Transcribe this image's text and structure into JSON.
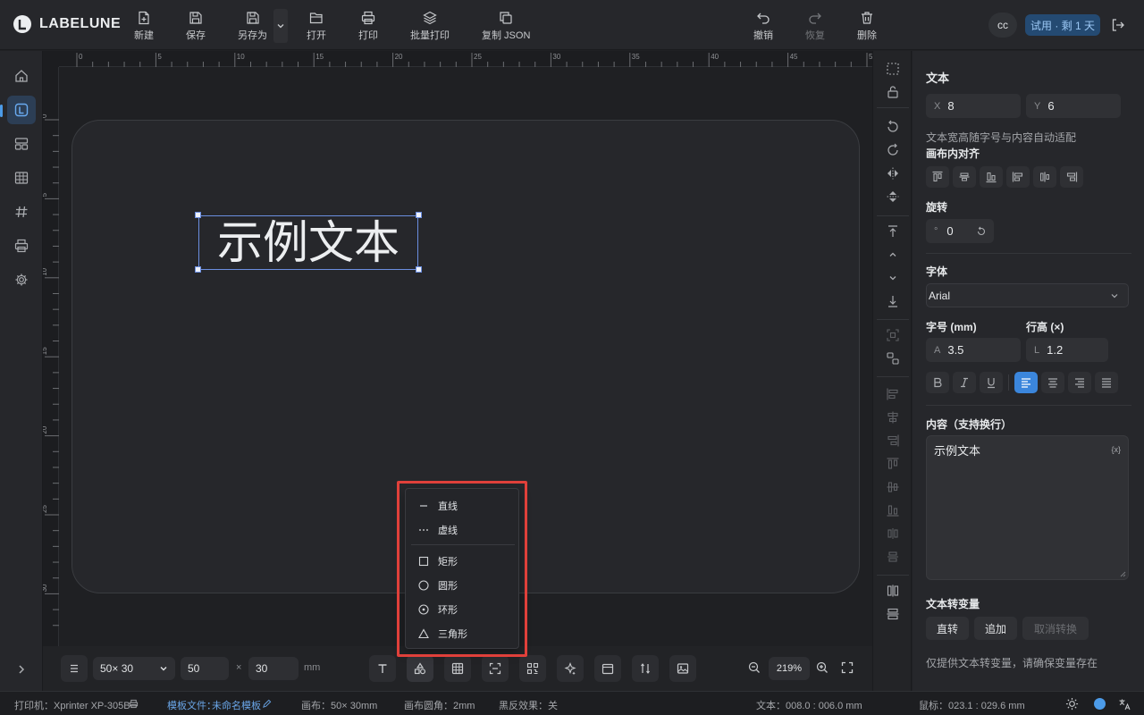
{
  "brand": {
    "name": "LABELUNE"
  },
  "toolbar": {
    "new": "新建",
    "save": "保存",
    "save_as": "另存为",
    "open": "打开",
    "print": "打印",
    "batch_print": "批量打印",
    "copy_json": "复制 JSON",
    "undo": "撤销",
    "redo": "恢复",
    "delete": "删除"
  },
  "account": {
    "avatar": "cc",
    "trial": "试用 · 剩 1 天"
  },
  "ruler": {
    "top_ticks": [
      "0",
      "5",
      "10",
      "15",
      "20",
      "25",
      "30",
      "35",
      "40",
      "45",
      "50"
    ],
    "left_ticks": [
      "0",
      "5",
      "10",
      "15",
      "20",
      "25",
      "30"
    ]
  },
  "canvas": {
    "sample_text": "示例文本"
  },
  "shape_menu": {
    "items": [
      {
        "label": "直线",
        "icon": "line-icon"
      },
      {
        "label": "虚线",
        "icon": "dashed-line-icon"
      },
      {
        "label": "矩形",
        "icon": "rectangle-icon"
      },
      {
        "label": "圆形",
        "icon": "circle-icon"
      },
      {
        "label": "环形",
        "icon": "ring-icon"
      },
      {
        "label": "三角形",
        "icon": "triangle-icon"
      }
    ]
  },
  "bottombar": {
    "size_preset": "50× 30",
    "width": "50",
    "times": "×",
    "height": "30",
    "unit": "mm",
    "zoom": "219%"
  },
  "panel": {
    "title": "文本",
    "x_prefix": "X",
    "x": "8",
    "y_prefix": "Y",
    "y": "6",
    "auto_note": "文本宽高随字号与内容自动适配",
    "align_title": "画布内对齐",
    "rotate_title": "旋转",
    "rotate_prefix": "°",
    "rotate": "0",
    "font_title": "字体",
    "font": "Arial",
    "size_title": "字号 (mm)",
    "size_prefix": "A",
    "size": "3.5",
    "lh_title": "行高 (×)",
    "lh_prefix": "L",
    "lh": "1.2",
    "content_title": "内容（支持换行）",
    "content": "示例文本",
    "var_badge": "{x}",
    "var_title": "文本转变量",
    "btn_direct": "直转",
    "btn_append": "追加",
    "btn_cancel": "取消转换",
    "var_note": "仅提供文本转变量，请确保变量存在"
  },
  "status": {
    "printer": "打印机：Xprinter XP-305B",
    "template_label": "模板文件：",
    "template_name": "未命名模板",
    "canvas": "画布：50× 30mm",
    "corner": "画布圆角：2mm",
    "invert": "黑反效果：关",
    "text_pos": "文本：008.0 : 006.0 mm",
    "mouse": "鼠标：023.1 : 029.6 mm"
  },
  "colors": {
    "accent": "#3b86dc",
    "highlight": "#e0403a",
    "selection": "#6b8ee0"
  }
}
